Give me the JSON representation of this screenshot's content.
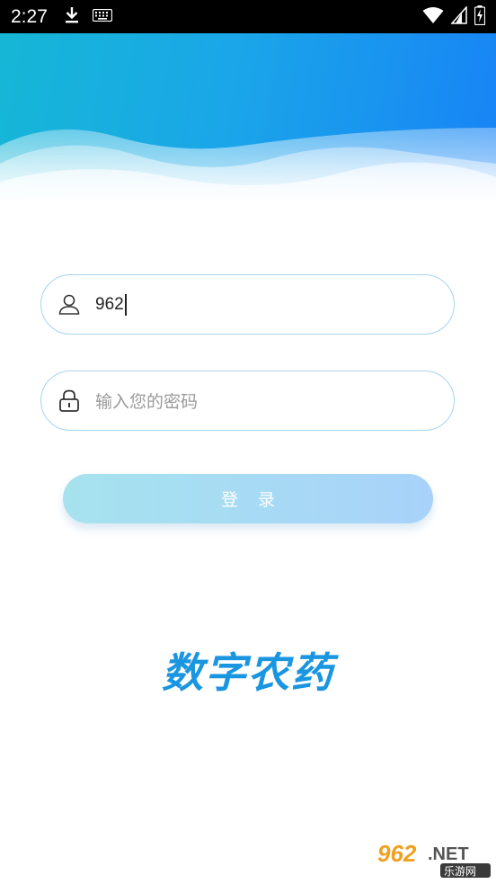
{
  "status_bar": {
    "time": "2:27",
    "icons": [
      "download-icon",
      "keyboard-icon",
      "wifi-icon",
      "signal-icon",
      "battery-charging-icon"
    ]
  },
  "login": {
    "username_value": "962",
    "password_placeholder": "输入您的密码",
    "button_label": "登录"
  },
  "app": {
    "logo_text": "数字农药"
  },
  "watermark": {
    "brand": "962.NET",
    "subtitle": "乐游网"
  },
  "colors": {
    "header_start": "#16b7d6",
    "header_end": "#1883f6",
    "accent": "#1a96e0",
    "field_border": "#a9d3ee"
  }
}
